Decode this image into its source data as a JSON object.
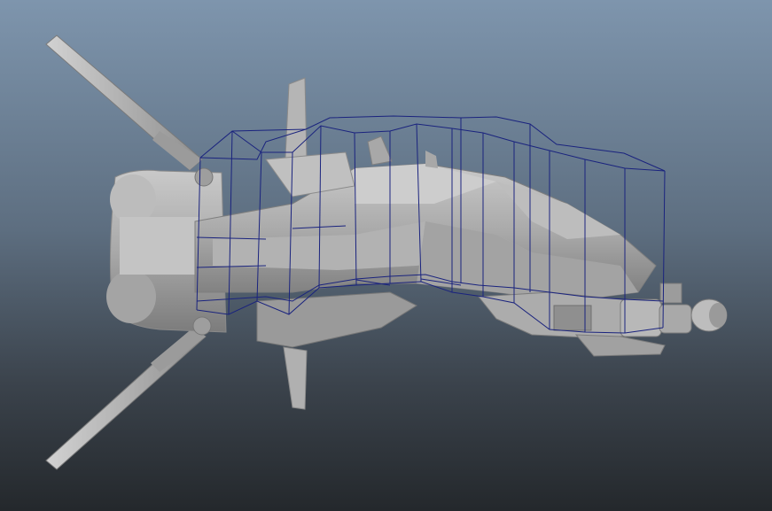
{
  "viewport": {
    "background_top": "#7e95ad",
    "background_bottom": "#24282c"
  },
  "model": {
    "surface_color": "#b9b9b9",
    "shade_color": "#8e8e8e",
    "dark_color": "#6f6f6f",
    "wireframe_color": "#1a237e"
  }
}
